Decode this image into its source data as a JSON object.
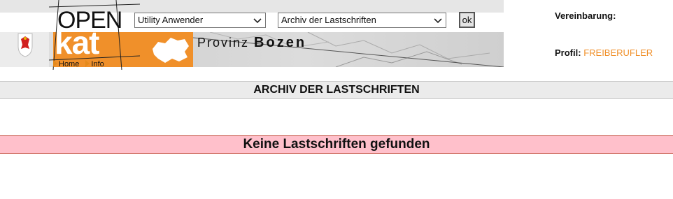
{
  "header": {
    "logo": {
      "line1": "OPEN",
      "line2": "kat"
    },
    "provinz_prefix": "Provinz",
    "provinz_name": "Bozen",
    "nav": [
      {
        "label": "Home"
      },
      {
        "label": "Info"
      }
    ],
    "controls": {
      "utility_select": {
        "selected": "Utility Anwender"
      },
      "archiv_select": {
        "selected": "Archiv der Lastschriften"
      },
      "ok_label": "ok"
    },
    "vereinbarung_label": "Vereinbarung:",
    "profil_label": "Profil:",
    "profil_value": "FREIBERUFLER"
  },
  "page_title": "ARCHIV DER LASTSCHRIFTEN",
  "message": "Keine Lastschriften gefunden",
  "colors": {
    "accent": "#f0902a",
    "message_bg": "#ffc0cb",
    "message_border": "#c0392b"
  }
}
